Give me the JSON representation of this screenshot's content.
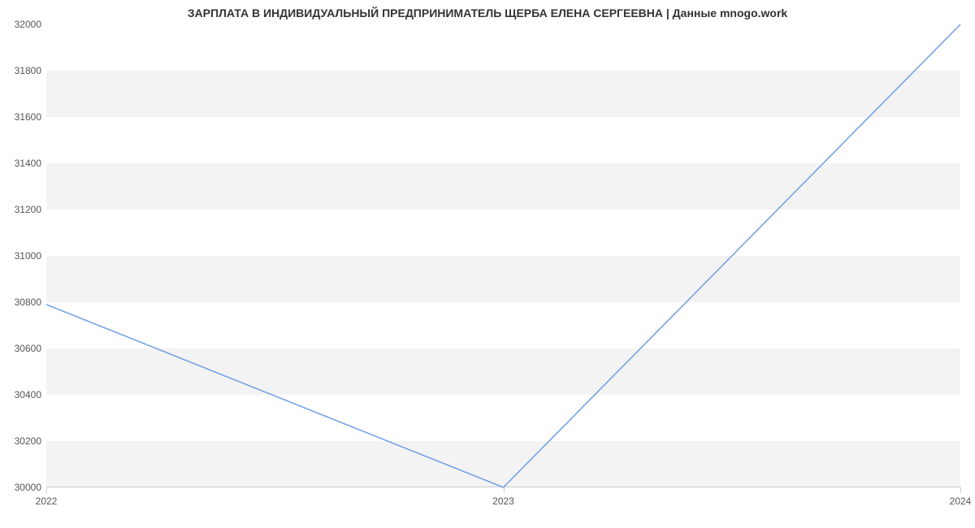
{
  "chart_data": {
    "type": "line",
    "title": "ЗАРПЛАТА В ИНДИВИДУАЛЬНЫЙ ПРЕДПРИНИМАТЕЛЬ ЩЕРБА ЕЛЕНА СЕРГЕЕВНА | Данные mnogo.work",
    "categories": [
      "2022",
      "2023",
      "2024"
    ],
    "values": [
      30790,
      30000,
      32000
    ],
    "xlabel": "",
    "ylabel": "",
    "yticks": [
      30000,
      30200,
      30400,
      30600,
      30800,
      31000,
      31200,
      31400,
      31600,
      31800,
      32000
    ],
    "ylim": [
      30000,
      32000
    ],
    "grid": true
  }
}
